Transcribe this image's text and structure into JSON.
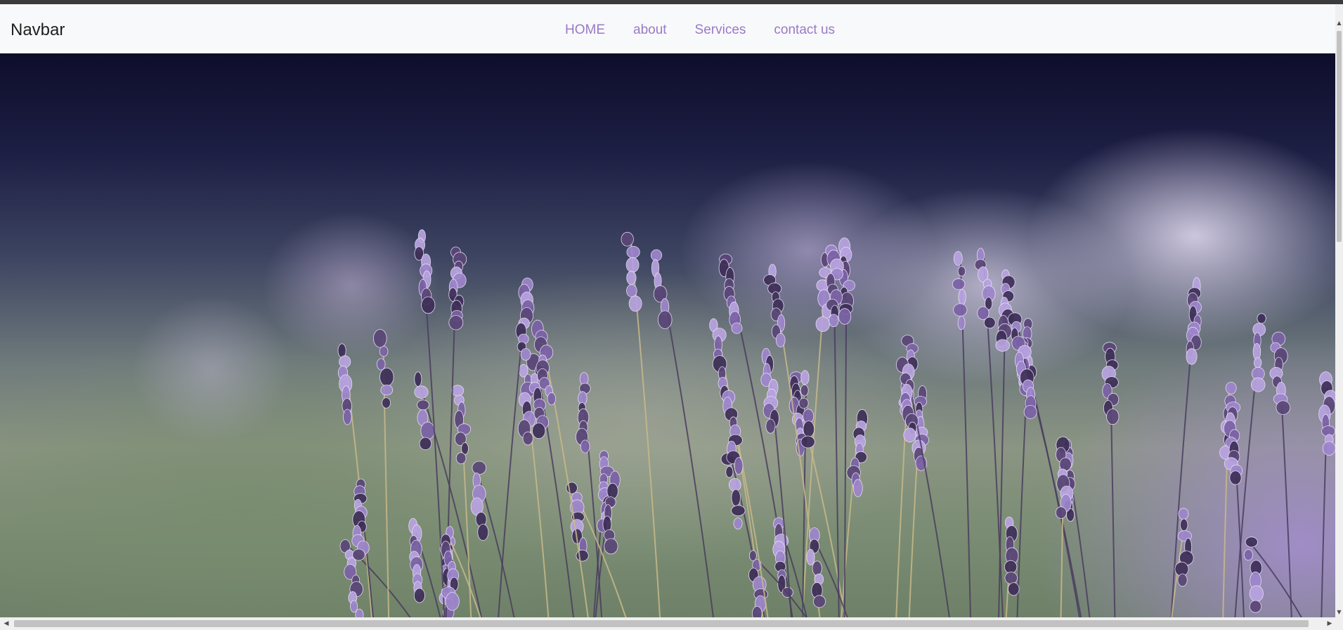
{
  "navbar": {
    "brand": "Navbar",
    "links": [
      {
        "label": "HOME"
      },
      {
        "label": "about"
      },
      {
        "label": "Services"
      },
      {
        "label": "contact us"
      }
    ]
  },
  "hero": {
    "image_subject": "lavender-flowers-photo"
  },
  "scrollbars": {
    "up_arrow": "▲",
    "down_arrow": "▼",
    "left_arrow": "◀",
    "right_arrow": "▶"
  },
  "colors": {
    "nav_link": "#9b79c8",
    "navbar_bg": "#f8f9fa",
    "brand_text": "#1f1f1f"
  }
}
